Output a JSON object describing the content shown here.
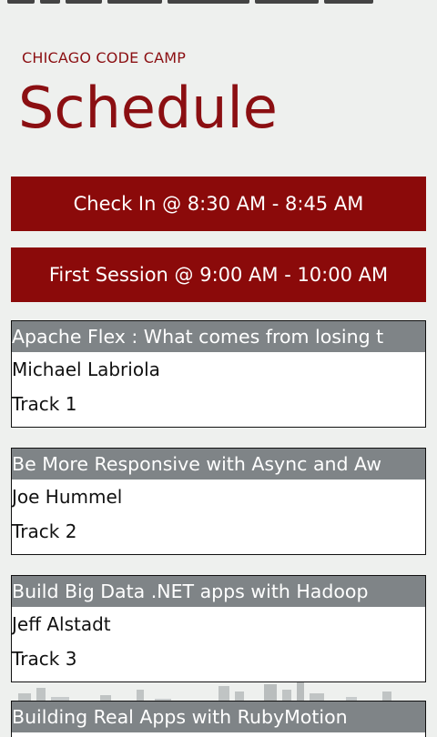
{
  "header": {
    "app_title": "CHICAGO CODE CAMP",
    "page_title": "Schedule"
  },
  "time_slots": [
    {
      "label": "Check In @ 8:30 AM - 8:45 AM"
    },
    {
      "label": "First Session @ 9:00 AM - 10:00 AM"
    }
  ],
  "sessions": [
    {
      "title": "Apache Flex : What comes from losing t",
      "speaker": "Michael Labriola",
      "track": "Track 1"
    },
    {
      "title": "Be More Responsive with Async and Aw",
      "speaker": "Joe Hummel",
      "track": "Track 2"
    },
    {
      "title": "Build Big Data .NET apps with Hadoop",
      "speaker": "Jeff Alstadt",
      "track": "Track 3"
    },
    {
      "title": "Building Real Apps with RubyMotion",
      "speaker": "",
      "track": ""
    }
  ],
  "colors": {
    "accent": "#8b0f12",
    "button_bg": "#8b0a0a",
    "card_title_bg": "#7f8487",
    "background": "#eef0ee"
  }
}
